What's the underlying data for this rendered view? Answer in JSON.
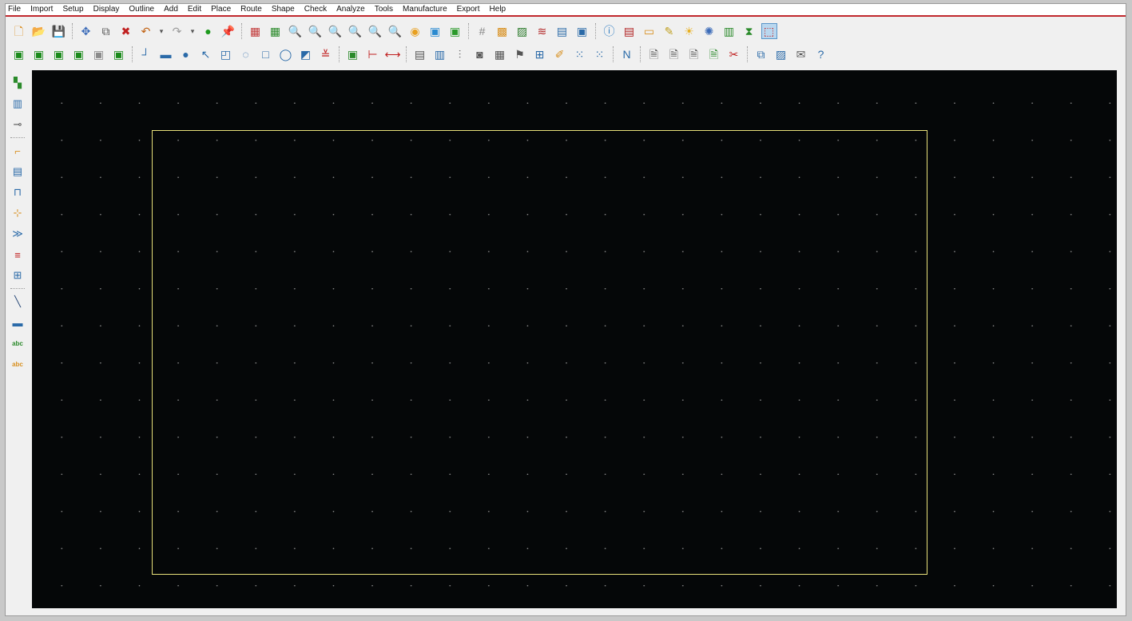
{
  "menu": [
    "File",
    "Import",
    "Setup",
    "Display",
    "Outline",
    "Add",
    "Edit",
    "Place",
    "Route",
    "Shape",
    "Check",
    "Analyze",
    "Tools",
    "Manufacture",
    "Export",
    "Help"
  ],
  "toolbar1": [
    {
      "name": "new-file-icon",
      "glyph": "🗋",
      "color": "#d98a1a"
    },
    {
      "name": "open-folder-icon",
      "glyph": "📂",
      "color": "#d9a62a"
    },
    {
      "name": "save-icon",
      "glyph": "💾",
      "color": "#4a6fa8"
    },
    {
      "sep": true
    },
    {
      "name": "move-icon",
      "glyph": "✥",
      "color": "#3a6ab8"
    },
    {
      "name": "copy-icon",
      "glyph": "⧉",
      "color": "#555"
    },
    {
      "name": "delete-icon",
      "glyph": "✖",
      "color": "#c02020"
    },
    {
      "name": "undo-icon",
      "glyph": "↶",
      "color": "#c06010"
    },
    {
      "name": "undo-dropdown-icon",
      "glyph": "▾",
      "small": true
    },
    {
      "name": "redo-icon",
      "glyph": "↷",
      "color": "#999"
    },
    {
      "name": "redo-dropdown-icon",
      "glyph": "▾",
      "small": true
    },
    {
      "name": "comment-icon",
      "glyph": "●",
      "color": "#1e9a1e"
    },
    {
      "name": "pin-icon",
      "glyph": "📌",
      "color": "#2a8a2a"
    },
    {
      "sep": true
    },
    {
      "name": "grid-view-icon",
      "glyph": "▦",
      "color": "#c23a3a"
    },
    {
      "name": "grid-view-2-icon",
      "glyph": "▦",
      "color": "#2a8a2a"
    },
    {
      "name": "zoom-area-icon",
      "glyph": "🔍",
      "color": "#3a6ab8"
    },
    {
      "name": "zoom-fit-icon",
      "glyph": "🔍",
      "color": "#c03030"
    },
    {
      "name": "zoom-in-icon",
      "glyph": "🔍",
      "color": "#2a7ac0"
    },
    {
      "name": "zoom-out-icon",
      "glyph": "🔍",
      "color": "#2a7ac0"
    },
    {
      "name": "zoom-previous-icon",
      "glyph": "🔍",
      "color": "#2a7ac0"
    },
    {
      "name": "zoom-world-icon",
      "glyph": "🔍",
      "color": "#2a7ac0"
    },
    {
      "name": "refresh-icon",
      "glyph": "◉",
      "color": "#e8a020"
    },
    {
      "name": "3d-view-icon",
      "glyph": "▣",
      "color": "#2a8ad0"
    },
    {
      "name": "flip-board-icon",
      "glyph": "▣",
      "color": "#2a9a2a"
    },
    {
      "sep": true
    },
    {
      "name": "grid-icon",
      "glyph": "#",
      "color": "#888"
    },
    {
      "name": "color-palette-icon",
      "glyph": "▩",
      "color": "#d89020"
    },
    {
      "name": "layer-visibility-icon",
      "glyph": "▨",
      "color": "#2a7a2a"
    },
    {
      "name": "layers-icon",
      "glyph": "≋",
      "color": "#b02020"
    },
    {
      "name": "tech-layers-icon",
      "glyph": "▤",
      "color": "#2a6aa8"
    },
    {
      "name": "board-view-icon",
      "glyph": "▣",
      "color": "#2a6aa8"
    },
    {
      "sep": true
    },
    {
      "name": "info-icon",
      "glyph": "ⓘ",
      "color": "#2a7ac0"
    },
    {
      "name": "properties-icon",
      "glyph": "▤",
      "color": "#b02020"
    },
    {
      "name": "measure-icon",
      "glyph": "▭",
      "color": "#d89020"
    },
    {
      "name": "highlight-icon",
      "glyph": "✎",
      "color": "#c0a020"
    },
    {
      "name": "sun-icon",
      "glyph": "☀",
      "color": "#e8b020"
    },
    {
      "name": "dehighlight-icon",
      "glyph": "✺",
      "color": "#3a6ab8"
    },
    {
      "name": "statistics-icon",
      "glyph": "▥",
      "color": "#2a8a2a"
    },
    {
      "name": "hourglass-icon",
      "glyph": "⧗",
      "color": "#2a8a2a"
    },
    {
      "name": "select-mode-icon",
      "glyph": "⬚",
      "color": "#c02020",
      "active": true
    }
  ],
  "toolbar2": [
    {
      "name": "board-top-icon",
      "glyph": "▣",
      "color": "#1a8a1a"
    },
    {
      "name": "board-bottom-icon",
      "glyph": "▣",
      "color": "#1a8a1a"
    },
    {
      "name": "board-layer-icon",
      "glyph": "▣",
      "color": "#1a8a1a"
    },
    {
      "name": "board-route-icon",
      "glyph": "▣",
      "color": "#1a8a1a"
    },
    {
      "name": "board-gray-icon",
      "glyph": "▣",
      "color": "#8a8a8a"
    },
    {
      "name": "board-outline-icon",
      "glyph": "▣",
      "color": "#1a8a1a"
    },
    {
      "sep": true
    },
    {
      "name": "add-line-icon",
      "glyph": "┘",
      "color": "#2a6aa8"
    },
    {
      "name": "add-rectangle-icon",
      "glyph": "▬",
      "color": "#2a6aa8"
    },
    {
      "name": "add-circle-icon",
      "glyph": "●",
      "color": "#2a6aa8"
    },
    {
      "name": "select-shape-icon",
      "glyph": "↖",
      "color": "#2a6aa8"
    },
    {
      "name": "add-frame-icon",
      "glyph": "◰",
      "color": "#2a6aa8"
    },
    {
      "name": "add-arc-icon",
      "glyph": "◌",
      "color": "#2a6aa8"
    },
    {
      "name": "add-square-icon",
      "glyph": "□",
      "color": "#2a6aa8"
    },
    {
      "name": "add-octagon-icon",
      "glyph": "◯",
      "color": "#2a6aa8"
    },
    {
      "name": "add-chamfer-icon",
      "glyph": "◩",
      "color": "#2a6aa8"
    },
    {
      "name": "shape-merge-icon",
      "glyph": "≚",
      "color": "#c02020"
    },
    {
      "sep": true
    },
    {
      "name": "place-component-icon",
      "glyph": "▣",
      "color": "#2a8a2a"
    },
    {
      "name": "dimension-icon",
      "glyph": "⊢",
      "color": "#c02020"
    },
    {
      "name": "dimension-2-icon",
      "glyph": "⟷",
      "color": "#c02020"
    },
    {
      "sep": true
    },
    {
      "name": "drc-icon",
      "glyph": "▤",
      "color": "#555"
    },
    {
      "name": "align-icon",
      "glyph": "▥",
      "color": "#2a6aa8"
    },
    {
      "name": "spread-icon",
      "glyph": "⫶",
      "color": "#555"
    },
    {
      "name": "camera-icon",
      "glyph": "◙",
      "color": "#555"
    },
    {
      "name": "netlist-icon",
      "glyph": "▦",
      "color": "#555"
    },
    {
      "name": "flag-icon",
      "glyph": "⚑",
      "color": "#555"
    },
    {
      "name": "square-grid-icon",
      "glyph": "⊞",
      "color": "#2a6aa8"
    },
    {
      "name": "probe-icon",
      "glyph": "✐",
      "color": "#d89020"
    },
    {
      "name": "dots-grid-icon",
      "glyph": "⁙",
      "color": "#2a6aa8"
    },
    {
      "name": "matrix-icon",
      "glyph": "⁙",
      "color": "#2a6aa8"
    },
    {
      "sep": true
    },
    {
      "name": "signal-icon",
      "glyph": "Ν",
      "color": "#2a6aa8"
    },
    {
      "sep": true
    },
    {
      "name": "doc-icon",
      "glyph": "🗎",
      "color": "#555"
    },
    {
      "name": "doc-add-icon",
      "glyph": "🗎",
      "color": "#555"
    },
    {
      "name": "doc-edit-icon",
      "glyph": "🗎",
      "color": "#555"
    },
    {
      "name": "doc-check-icon",
      "glyph": "🗎",
      "color": "#2a8a2a"
    },
    {
      "name": "scissors-icon",
      "glyph": "✂",
      "color": "#c02020"
    },
    {
      "sep": true
    },
    {
      "name": "windows-icon",
      "glyph": "⧉",
      "color": "#2a6aa8"
    },
    {
      "name": "chart-icon",
      "glyph": "▨",
      "color": "#2a6aa8"
    },
    {
      "name": "mail-icon",
      "glyph": "✉",
      "color": "#555"
    },
    {
      "name": "help-icon",
      "glyph": "?",
      "color": "#2a6aa8"
    }
  ],
  "lefttools": [
    {
      "name": "component-icon",
      "glyph": "▚",
      "color": "#2a8a2a"
    },
    {
      "name": "chip-icon",
      "glyph": "▥",
      "color": "#2a6aa8"
    },
    {
      "name": "connector-icon",
      "glyph": "⊸",
      "color": "#555"
    },
    {
      "sep": true
    },
    {
      "name": "route-step-icon",
      "glyph": "⌐",
      "color": "#d89020"
    },
    {
      "name": "route-table-icon",
      "glyph": "▤",
      "color": "#2a6aa8"
    },
    {
      "name": "route-pulse-icon",
      "glyph": "⊓",
      "color": "#2a6aa8"
    },
    {
      "name": "route-connect-icon",
      "glyph": "⊹",
      "color": "#d89020"
    },
    {
      "name": "route-bend-icon",
      "glyph": "≫",
      "color": "#2a6aa8"
    },
    {
      "name": "route-bus-icon",
      "glyph": "≡",
      "color": "#c02020"
    },
    {
      "name": "route-grid-icon",
      "glyph": "⊞",
      "color": "#2a6aa8"
    },
    {
      "sep": true
    },
    {
      "name": "line-tool-icon",
      "glyph": "╲",
      "color": "#2a4a78"
    },
    {
      "name": "rectangle-tool-icon",
      "glyph": "▬",
      "color": "#2a6aa8"
    },
    {
      "name": "text-add-icon",
      "glyph": "abc",
      "color": "#2a8a2a"
    },
    {
      "name": "text-edit-icon",
      "glyph": "abc",
      "color": "#d89020"
    }
  ]
}
